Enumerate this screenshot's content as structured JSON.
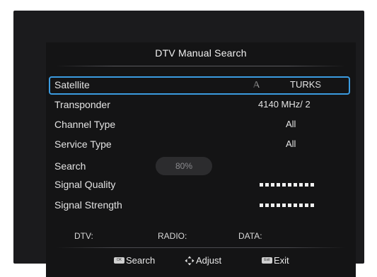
{
  "title": "DTV Manual Search",
  "rows": {
    "satellite": {
      "label": "Satellite",
      "value_prefix": "A",
      "value": "TURKS"
    },
    "transponder": {
      "label": "Transponder",
      "value": "4140 MHz/ 2"
    },
    "channel_type": {
      "label": "Channel Type",
      "value": "All"
    },
    "service_type": {
      "label": "Service Type",
      "value": "All"
    },
    "search": {
      "label": "Search",
      "progress_text": "80%",
      "progress": 0.8
    },
    "signal_quality": {
      "label": "Signal Quality"
    },
    "signal_strength": {
      "label": "Signal Strength"
    }
  },
  "counts": {
    "dtv": "DTV:",
    "radio": "RADIO:",
    "data": "DATA:"
  },
  "footer": {
    "search": {
      "key": "OK",
      "label": "Search",
      "icon": "ok-key-icon"
    },
    "adjust": {
      "label": "Adjust",
      "icon": "four-way-arrows-icon"
    },
    "exit": {
      "key": "Exit",
      "label": "Exit",
      "icon": "exit-key-icon"
    }
  },
  "colors": {
    "selection_border": "#3b9be0",
    "panel_background": "#141415"
  }
}
